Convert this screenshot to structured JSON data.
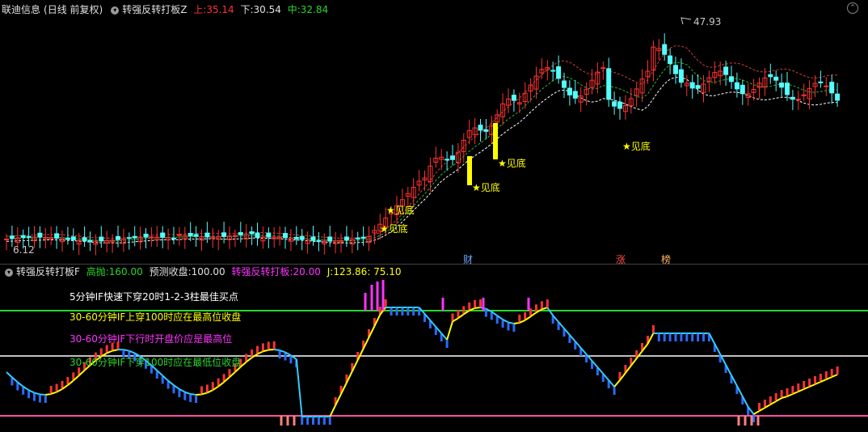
{
  "upper": {
    "stock_name": "联迪信息",
    "period": "(日线 前复权)",
    "indicator": "转强反转打板Z",
    "up_label": "上:",
    "up_value": "35.14",
    "down_label": "下:",
    "down_value": "30.54",
    "mid_label": "中:",
    "mid_value": "32.84",
    "high_label": "47.93",
    "low_label": "6.12",
    "annotations": [
      "★见底",
      "★见底",
      "★见底",
      "★见底",
      "★见底",
      "★见底",
      "★见底"
    ],
    "ann_texts": {
      "a1": "★见底",
      "a2": "★见底",
      "a3": "★见底",
      "a4": "★见底",
      "a5": "★见底",
      "a6": "★见底",
      "b1": "★见底",
      "c1": "★见底",
      "d1": "★见底"
    }
  },
  "events": {
    "e1": "财",
    "e2": "涨",
    "e3": "榜"
  },
  "lower": {
    "indicator": "转强反转打板F",
    "high_sell_label": "高抛:",
    "high_sell_value": "160.00",
    "forecast_label": "预测收盘:",
    "forecast_value": "100.00",
    "zq_label": "转强反转打板:",
    "zq_value": "20.00",
    "j_label": "J:",
    "j_value": "123.86",
    "j_value2": ": 75.10",
    "notes": {
      "n1": "5分钟IF快速下穿20时1-2-3柱最佳买点",
      "n2": "30-60分钟IF上穿100时应在最高位收盘",
      "n3": "30-60分钟IF下行时开盘价应是最高位",
      "n4": "30-60分钟IF下穿100时应在最低位收盘"
    }
  },
  "colors": {
    "up": "#ff3232",
    "down": "#54ffff",
    "yellow": "#ffff00",
    "green": "#2ad62a",
    "magenta": "#ff33ff",
    "pink": "#ff4da6"
  }
}
